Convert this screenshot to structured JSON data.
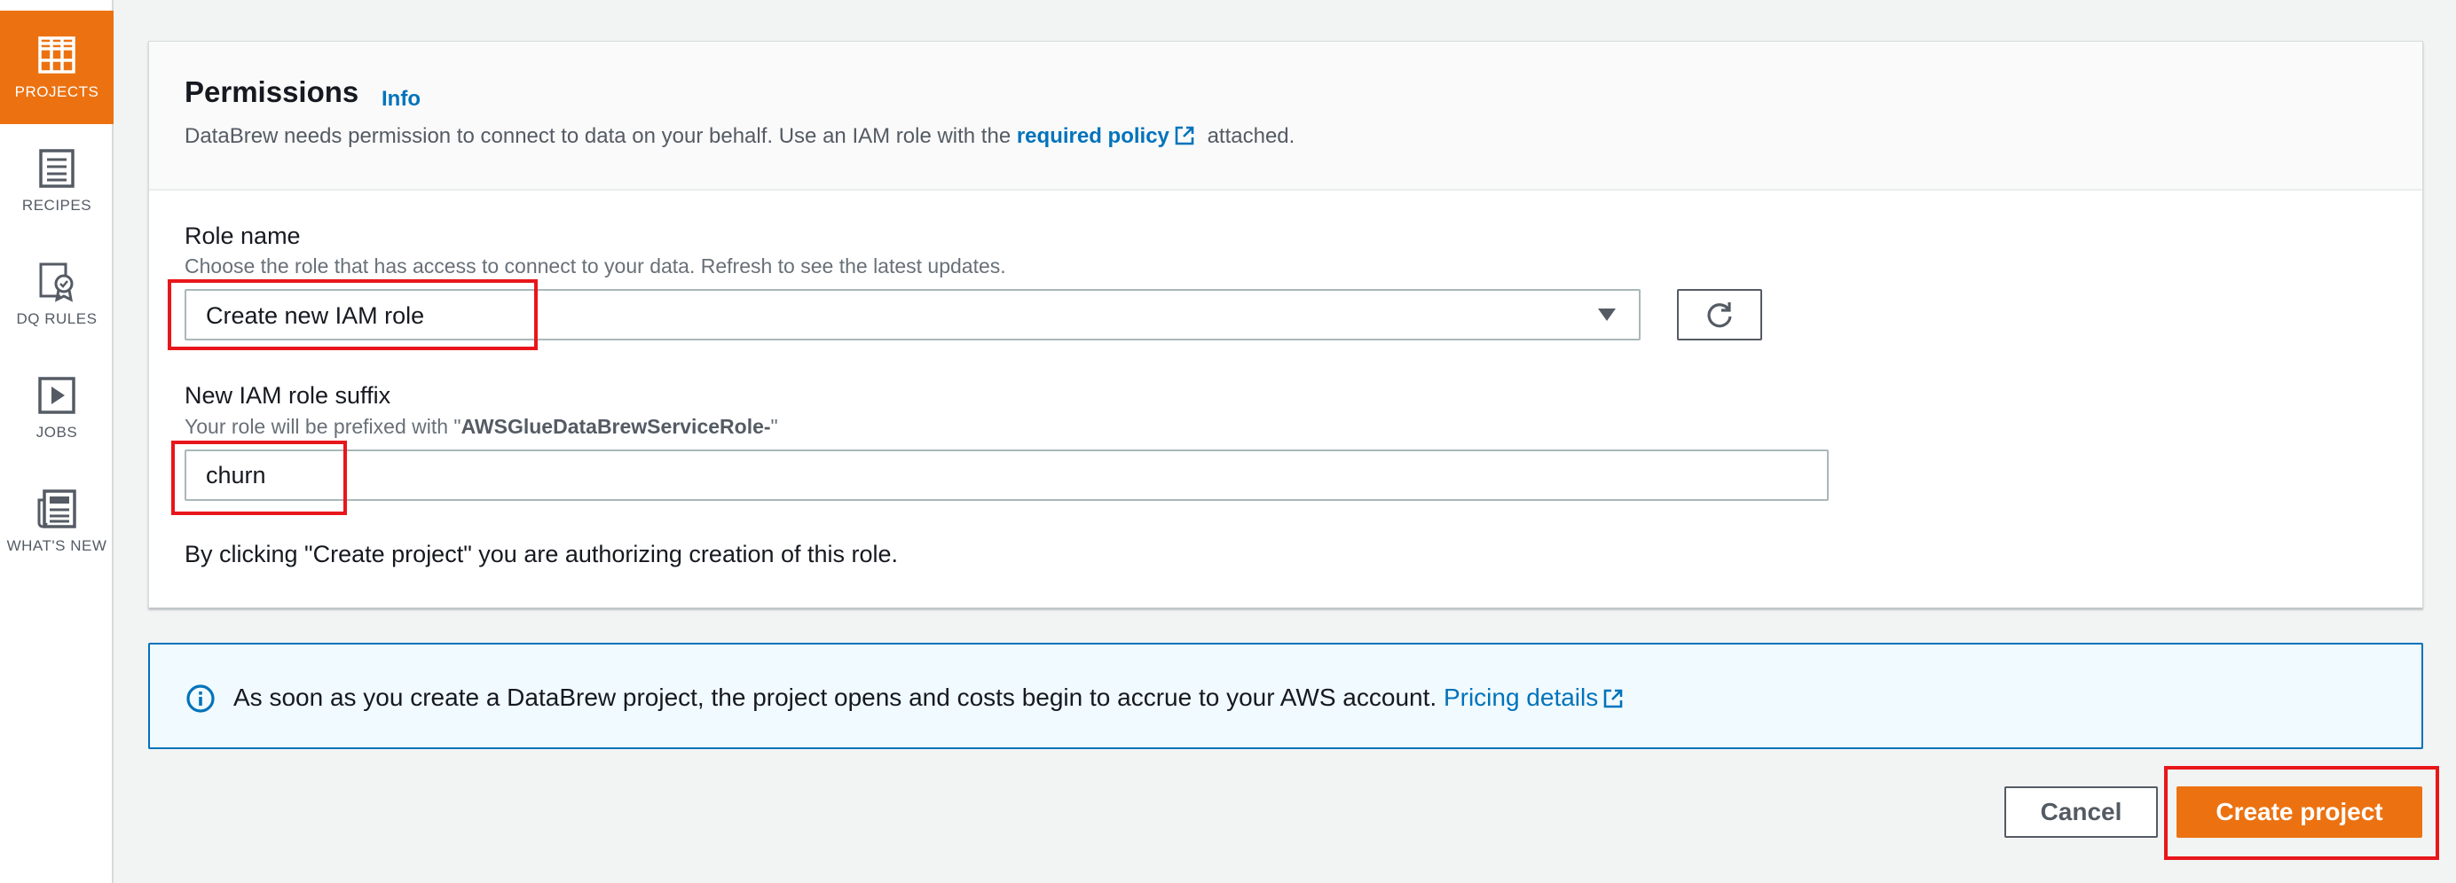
{
  "nav": {
    "items": [
      {
        "label": "PROJECTS",
        "icon": "projects-grid-icon",
        "active": true
      },
      {
        "label": "RECIPES",
        "icon": "recipes-list-icon",
        "active": false
      },
      {
        "label": "DQ RULES",
        "icon": "dq-rules-badge-icon",
        "active": false
      },
      {
        "label": "JOBS",
        "icon": "jobs-play-icon",
        "active": false
      },
      {
        "label": "WHAT'S NEW",
        "icon": "whats-new-news-icon",
        "active": false
      }
    ]
  },
  "permissions": {
    "title": "Permissions",
    "info_label": "Info",
    "desc_prefix": "DataBrew needs permission to connect to data on your behalf. Use an IAM role with the",
    "desc_link": "required policy",
    "desc_suffix": "attached.",
    "role_name": {
      "label": "Role name",
      "hint": "Choose the role that has access to connect to your data. Refresh to see the latest updates.",
      "selected": "Create new IAM role"
    },
    "suffix": {
      "label": "New IAM role suffix",
      "hint_prefix": "Your role will be prefixed with \"",
      "hint_bold": "AWSGlueDataBrewServiceRole-",
      "hint_suffix": "\"",
      "value": "churn"
    },
    "consent": "By clicking \"Create project\" you are authorizing creation of this role."
  },
  "alert": {
    "text": "As soon as you create a DataBrew project, the project opens and costs begin to accrue to your AWS account.",
    "link": "Pricing details"
  },
  "footer": {
    "cancel_label": "Cancel",
    "create_label": "Create project"
  },
  "colors": {
    "accent": "#ec7211",
    "link": "#0073bb",
    "highlight": "#e8161b",
    "alert_bg": "#f1faff"
  }
}
